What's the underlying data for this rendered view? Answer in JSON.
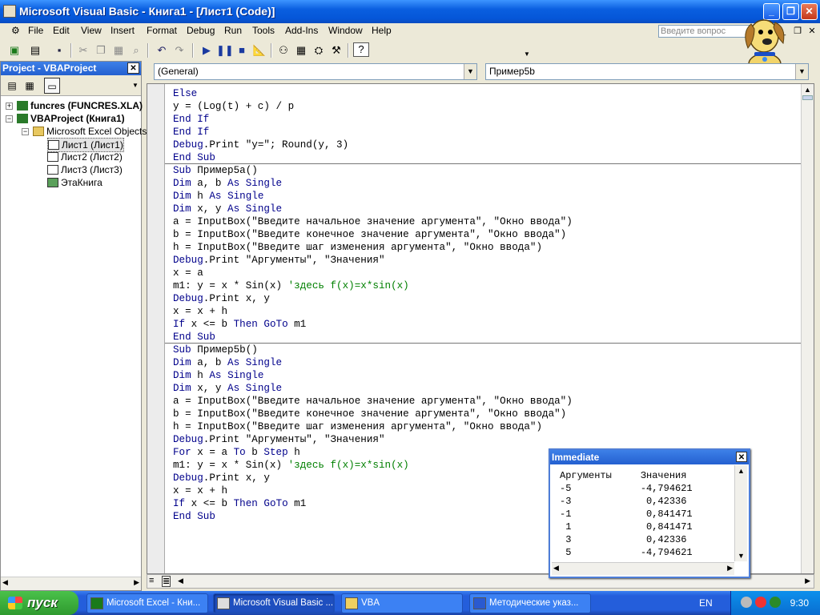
{
  "window": {
    "title": "Microsoft Visual Basic - Книга1 - [Лист1 (Code)]"
  },
  "menu": {
    "items": [
      "File",
      "Edit",
      "View",
      "Insert",
      "Format",
      "Debug",
      "Run",
      "Tools",
      "Add-Ins",
      "Window",
      "Help"
    ]
  },
  "help_placeholder": "Введите вопрос",
  "project": {
    "title": "Project - VBAProject",
    "tree": [
      {
        "label": "funcres (FUNCRES.XLA)"
      },
      {
        "label": "VBAProject (Книга1)"
      },
      {
        "label": "Microsoft Excel Objects"
      },
      {
        "label": "Лист1 (Лист1)"
      },
      {
        "label": "Лист2 (Лист2)"
      },
      {
        "label": "Лист3 (Лист3)"
      },
      {
        "label": "ЭтаКнига"
      }
    ]
  },
  "code_window": {
    "object_combo": "(General)",
    "proc_combo": "Пример5b"
  },
  "code": {
    "lines": [
      "Else",
      "y = (Log(t) + c) / p",
      "End If",
      "End If",
      "Debug.Print \"y=\"; Round(y, 3)",
      "End Sub",
      "Sub Пример5a()",
      "Dim a, b As Single",
      "Dim h As Single",
      "Dim x, y As Single",
      "a = InputBox(\"Введите начальное значение аргумента\", \"Окно ввода\")",
      "b = InputBox(\"Введите конечное значение аргумента\", \"Окно ввода\")",
      "h = InputBox(\"Введите шаг изменения аргумента\", \"Окно ввода\")",
      "Debug.Print \"Аргументы\", \"Значения\"",
      "x = a",
      "m1: y = x * Sin(x) 'здесь f(x)=x*sin(x)",
      "Debug.Print x, y",
      "x = x + h",
      "If x <= b Then GoTo m1",
      "End Sub",
      "Sub Пример5b()",
      "Dim a, b As Single",
      "Dim h As Single",
      "Dim x, y As Single",
      "a = InputBox(\"Введите начальное значение аргумента\", \"Окно ввода\")",
      "b = InputBox(\"Введите конечное значение аргумента\", \"Окно ввода\")",
      "h = InputBox(\"Введите шаг изменения аргумента\", \"Окно ввода\")",
      "Debug.Print \"Аргументы\", \"Значения\"",
      "For x = a To b Step h",
      "m1: y = x * Sin(x) 'здесь f(x)=x*sin(x)",
      "Debug.Print x, y",
      "x = x + h",
      "If x <= b Then GoTo m1",
      "End Sub"
    ]
  },
  "immediate": {
    "title": "Immediate",
    "lines": [
      "Аргументы     Значения",
      "-5            -4,794621",
      "-3             0,42336",
      "-1             0,841471",
      " 1             0,841471",
      " 3             0,42336",
      " 5            -4,794621"
    ]
  },
  "taskbar": {
    "start_label": "пуск",
    "tasks": [
      "Microsoft Excel - Кни...",
      "Microsoft Visual Basic ...",
      "VBA",
      "Методические указ..."
    ],
    "lang": "EN",
    "clock": "9:30"
  }
}
